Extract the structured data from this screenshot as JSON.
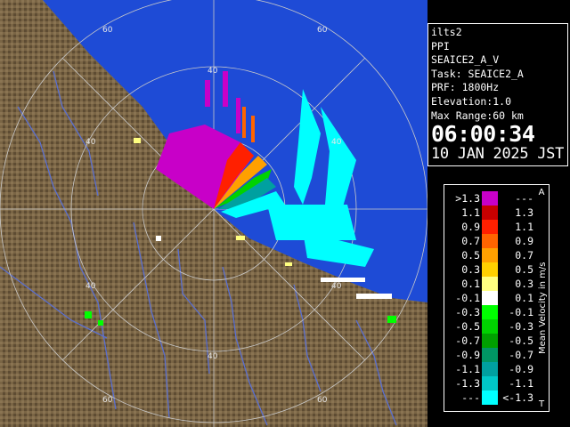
{
  "map": {
    "range_labels": [
      "60",
      "60",
      "40",
      "40",
      "40",
      "40",
      "40",
      "60",
      "60"
    ],
    "colors": {
      "land": "#7a6545",
      "sea": "#1e4bd6",
      "rings": "#c9c9c9",
      "rivers": "#5a6fd0"
    }
  },
  "info": {
    "site": "ilts2",
    "mode": "PPI",
    "scan": "SEAICE2_A_V",
    "task": "Task: SEAICE2_A",
    "prf": "PRF: 1800Hz",
    "elevation": "Elevation:1.0",
    "max_range": "Max Range:60 km",
    "time": "06:00:34",
    "date": "10 JAN 2025 JST"
  },
  "legend": {
    "title": "Mean Velocity in m/s",
    "top_marker": "A",
    "bottom_marker": "T",
    "rows": [
      {
        "lo": ">1.3",
        "hi": "---",
        "color": "#c800c8"
      },
      {
        "lo": "1.1",
        "hi": "1.3",
        "color": "#c80000"
      },
      {
        "lo": "0.9",
        "hi": "1.1",
        "color": "#ff2000"
      },
      {
        "lo": "0.7",
        "hi": "0.9",
        "color": "#ff6400"
      },
      {
        "lo": "0.5",
        "hi": "0.7",
        "color": "#ffa000"
      },
      {
        "lo": "0.3",
        "hi": "0.5",
        "color": "#ffd000"
      },
      {
        "lo": "0.1",
        "hi": "0.3",
        "color": "#ffff80"
      },
      {
        "lo": "-0.1",
        "hi": "0.1",
        "color": "#ffffff"
      },
      {
        "lo": "-0.3",
        "hi": "-0.1",
        "color": "#00ff00"
      },
      {
        "lo": "-0.5",
        "hi": "-0.3",
        "color": "#00d200"
      },
      {
        "lo": "-0.7",
        "hi": "-0.5",
        "color": "#00a000"
      },
      {
        "lo": "-0.9",
        "hi": "-0.7",
        "color": "#009664"
      },
      {
        "lo": "-1.1",
        "hi": "-0.9",
        "color": "#00a0a0"
      },
      {
        "lo": "-1.3",
        "hi": "-1.1",
        "color": "#00c8c8"
      },
      {
        "lo": "---",
        "hi": "<-1.3",
        "color": "#00ffff"
      }
    ]
  }
}
